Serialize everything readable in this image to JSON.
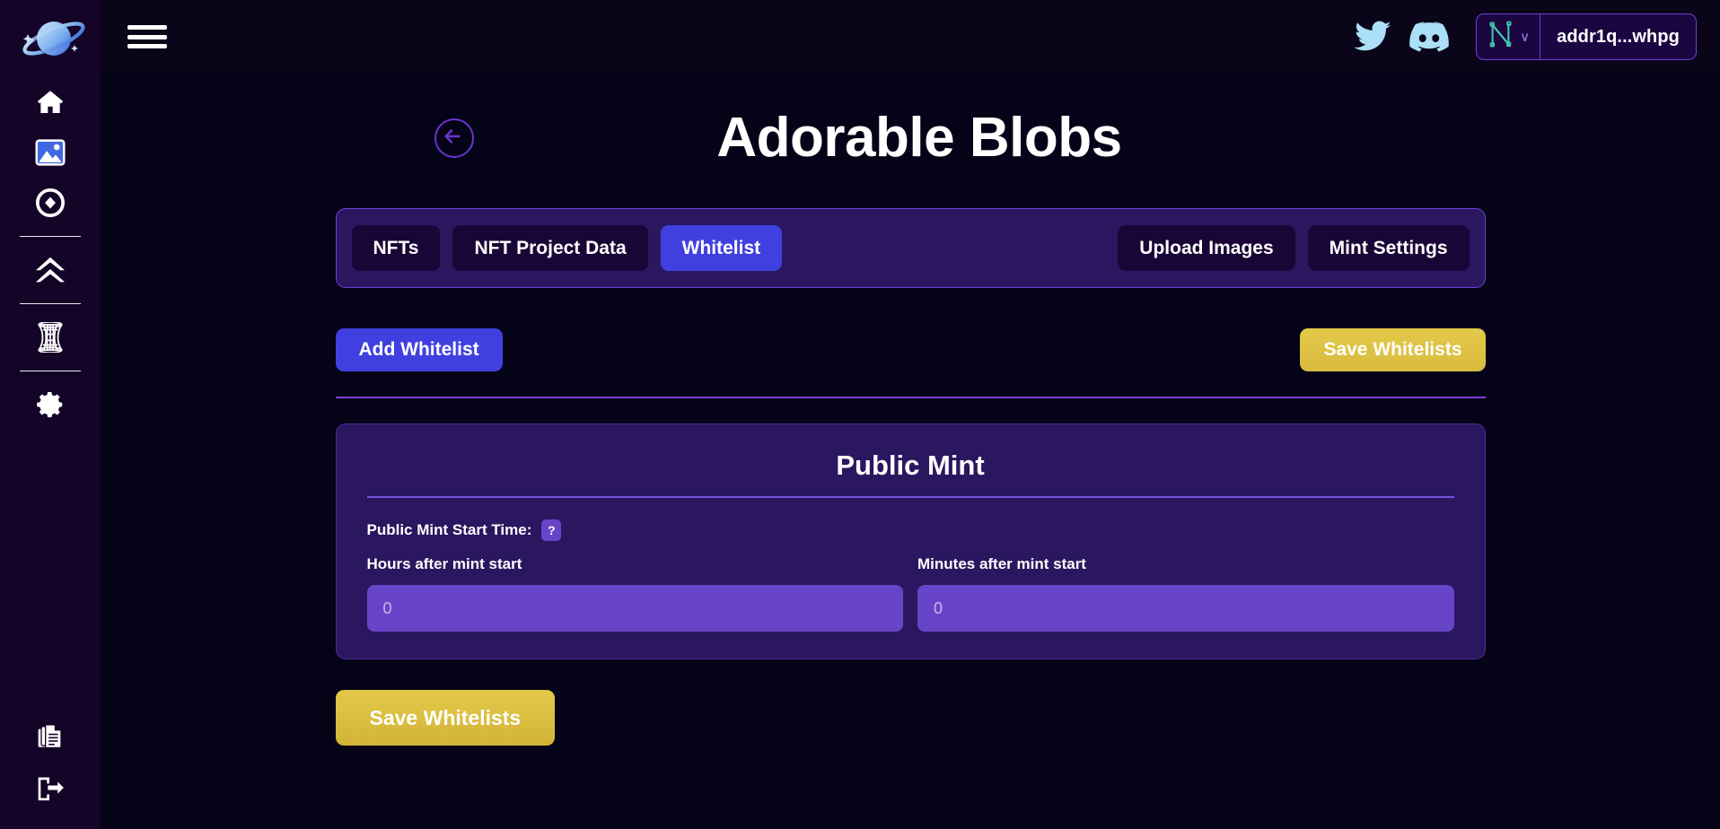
{
  "colors": {
    "app_bg": "#050317",
    "sidebar_bg": "#140427",
    "card_bg": "#2a1760",
    "tabbar_bg": "#2a1760",
    "tab_inactive_bg": "#1a0636",
    "accent_indigo": "#4040e0",
    "accent_purple": "#6844c8",
    "accent_gold": "#e3c94a",
    "border_purple": "#6c3fd8",
    "text_white": "#ffffff",
    "icon_blue": "#ace0f9",
    "nav_active_blue": "#4169e1"
  },
  "sidebar": {
    "logo_name": "planet-logo",
    "items": [
      {
        "icon": "home-icon",
        "name": "sidebar-item-home",
        "active": false
      },
      {
        "icon": "image-icon",
        "name": "sidebar-item-gallery",
        "active": true
      },
      {
        "icon": "compass-icon",
        "name": "sidebar-item-explore",
        "active": false
      },
      {
        "icon": "chevrons-up-icon",
        "name": "sidebar-item-upgrade",
        "active": false
      },
      {
        "icon": "wormhole-icon",
        "name": "sidebar-item-wormhole",
        "active": false
      },
      {
        "icon": "gear-icon",
        "name": "sidebar-item-settings",
        "active": false
      }
    ],
    "bottom_items": [
      {
        "icon": "documents-icon",
        "name": "sidebar-item-docs"
      },
      {
        "icon": "logout-icon",
        "name": "sidebar-item-logout"
      }
    ]
  },
  "topbar": {
    "menu_icon": "hamburger-icon",
    "twitter_icon": "twitter-icon",
    "discord_icon": "discord-icon",
    "wallet": {
      "provider_icon": "nami-wallet-icon",
      "chevron": "∨",
      "address": "addr1q...whpg"
    }
  },
  "page": {
    "back_icon": "arrow-left-icon",
    "title": "Adorable Blobs"
  },
  "tabs": {
    "left": [
      {
        "label": "NFTs",
        "active": false
      },
      {
        "label": "NFT Project Data",
        "active": false
      },
      {
        "label": "Whitelist",
        "active": true
      }
    ],
    "right": [
      {
        "label": "Upload Images",
        "active": false
      },
      {
        "label": "Mint Settings",
        "active": false
      }
    ]
  },
  "actions": {
    "add_whitelist_label": "Add Whitelist",
    "save_whitelists_label": "Save Whitelists"
  },
  "public_mint_card": {
    "title": "Public Mint",
    "start_time_label": "Public Mint Start Time:",
    "help_badge": "?",
    "hours": {
      "label": "Hours after mint start",
      "value": "",
      "placeholder": "0"
    },
    "minutes": {
      "label": "Minutes after mint start",
      "value": "",
      "placeholder": "0"
    }
  },
  "footer": {
    "save_whitelists_label": "Save Whitelists"
  }
}
